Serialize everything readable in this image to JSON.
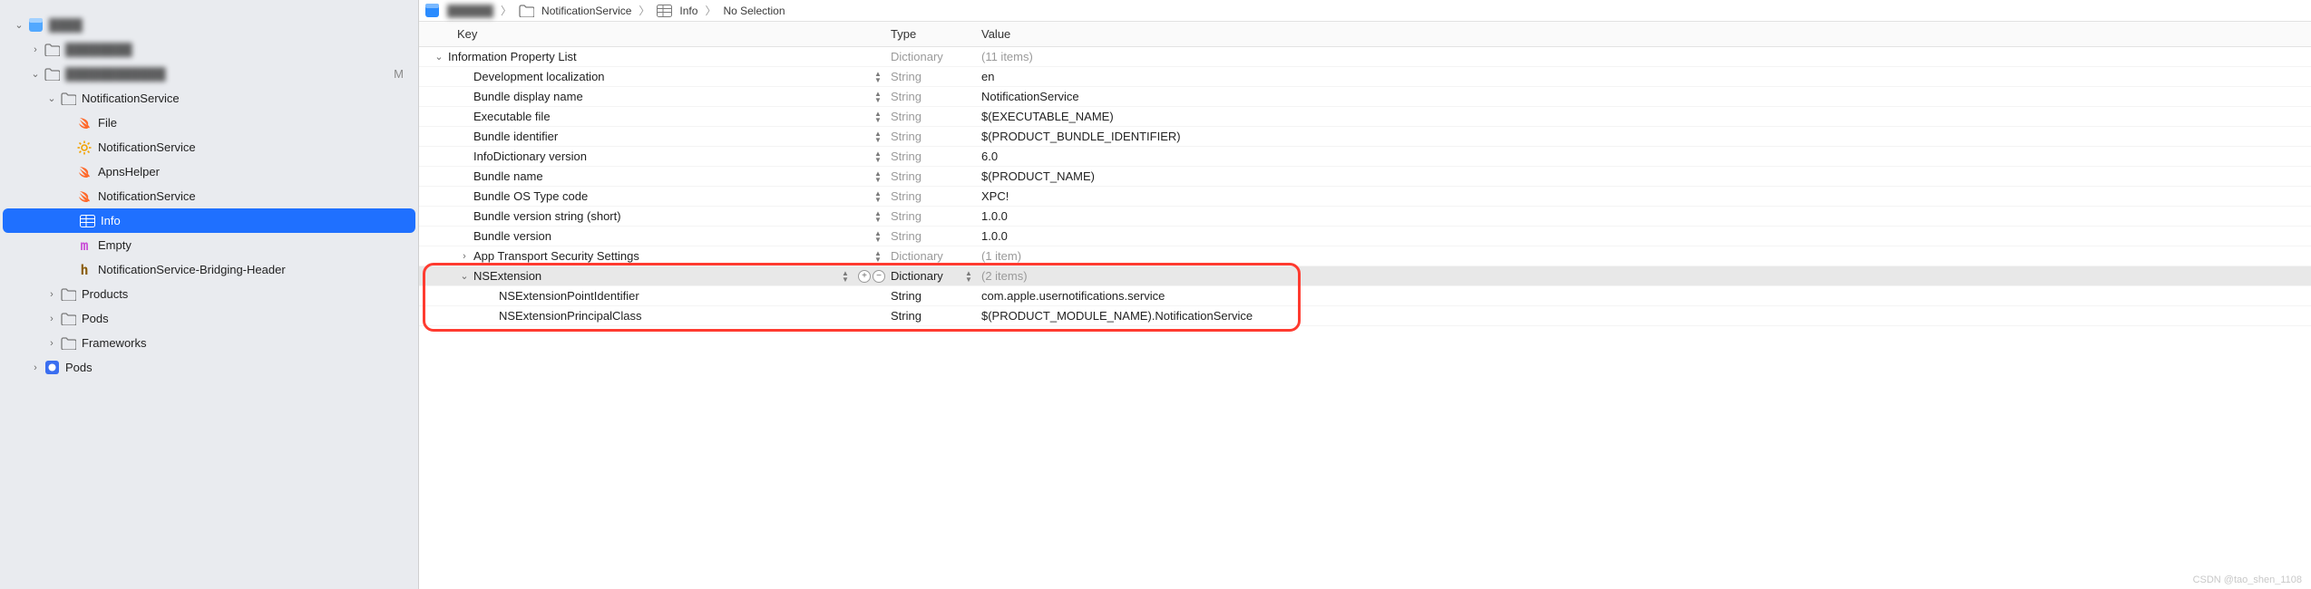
{
  "sidebar": {
    "root_blur": "████",
    "root_status": "M",
    "items": [
      {
        "label": "████",
        "icon": "proj",
        "depth": 0,
        "disc": "open",
        "blur": true
      },
      {
        "label": "████████",
        "icon": "folder",
        "depth": 1,
        "disc": "closed",
        "blur": true
      },
      {
        "label": "████████████",
        "icon": "folder",
        "depth": 1,
        "disc": "open",
        "status": "M",
        "blur": true
      },
      {
        "label": "NotificationService",
        "icon": "folder",
        "depth": 2,
        "disc": "open"
      },
      {
        "label": "File",
        "icon": "swift",
        "depth": 3
      },
      {
        "label": "NotificationService",
        "icon": "gear",
        "depth": 3
      },
      {
        "label": "ApnsHelper",
        "icon": "swift",
        "depth": 3
      },
      {
        "label": "NotificationService",
        "icon": "swift",
        "depth": 3
      },
      {
        "label": "Info",
        "icon": "plist",
        "depth": 3,
        "selected": true
      },
      {
        "label": "Empty",
        "icon": "m",
        "depth": 3
      },
      {
        "label": "NotificationService-Bridging-Header",
        "icon": "h",
        "depth": 3
      },
      {
        "label": "Products",
        "icon": "folder",
        "depth": 2,
        "disc": "closed"
      },
      {
        "label": "Pods",
        "icon": "folder",
        "depth": 2,
        "disc": "closed"
      },
      {
        "label": "Frameworks",
        "icon": "folder",
        "depth": 2,
        "disc": "closed"
      },
      {
        "label": "Pods",
        "icon": "pods",
        "depth": 1,
        "disc": "closed"
      }
    ]
  },
  "crumbs": {
    "c0_blur": "██████",
    "c1": "NotificationService",
    "c2": "Info",
    "c3": "No Selection"
  },
  "table": {
    "headers": {
      "key": "Key",
      "type": "Type",
      "value": "Value"
    }
  },
  "plist": [
    {
      "key": "Information Property List",
      "type": "Dictionary",
      "value": "(11 items)",
      "depth": 0,
      "disc": "open",
      "type_gray": true,
      "val_gray": true,
      "stepper": false
    },
    {
      "key": "Development localization",
      "type": "String",
      "value": "en",
      "depth": 1,
      "type_gray": true
    },
    {
      "key": "Bundle display name",
      "type": "String",
      "value": "NotificationService",
      "depth": 1,
      "type_gray": true
    },
    {
      "key": "Executable file",
      "type": "String",
      "value": "$(EXECUTABLE_NAME)",
      "depth": 1,
      "type_gray": true
    },
    {
      "key": "Bundle identifier",
      "type": "String",
      "value": "$(PRODUCT_BUNDLE_IDENTIFIER)",
      "depth": 1,
      "type_gray": true
    },
    {
      "key": "InfoDictionary version",
      "type": "String",
      "value": "6.0",
      "depth": 1,
      "type_gray": true
    },
    {
      "key": "Bundle name",
      "type": "String",
      "value": "$(PRODUCT_NAME)",
      "depth": 1,
      "type_gray": true
    },
    {
      "key": "Bundle OS Type code",
      "type": "String",
      "value": "XPC!",
      "depth": 1,
      "type_gray": true
    },
    {
      "key": "Bundle version string (short)",
      "type": "String",
      "value": "1.0.0",
      "depth": 1,
      "type_gray": true
    },
    {
      "key": "Bundle version",
      "type": "String",
      "value": "1.0.0",
      "depth": 1,
      "type_gray": true
    },
    {
      "key": "App Transport Security Settings",
      "type": "Dictionary",
      "value": "(1 item)",
      "depth": 1,
      "disc": "closed",
      "type_gray": true,
      "val_gray": true
    },
    {
      "key": "NSExtension",
      "type": "Dictionary",
      "value": "(2 items)",
      "depth": 1,
      "disc": "open",
      "selected": true,
      "type_gray": false,
      "val_gray": true,
      "plusminus": true,
      "type_stepper": true
    },
    {
      "key": "NSExtensionPointIdentifier",
      "type": "String",
      "value": "com.apple.usernotifications.service",
      "depth": 2,
      "stepper": false
    },
    {
      "key": "NSExtensionPrincipalClass",
      "type": "String",
      "value": "$(PRODUCT_MODULE_NAME).NotificationService",
      "depth": 2,
      "stepper": false
    }
  ],
  "watermark": "CSDN @tao_shen_1108"
}
